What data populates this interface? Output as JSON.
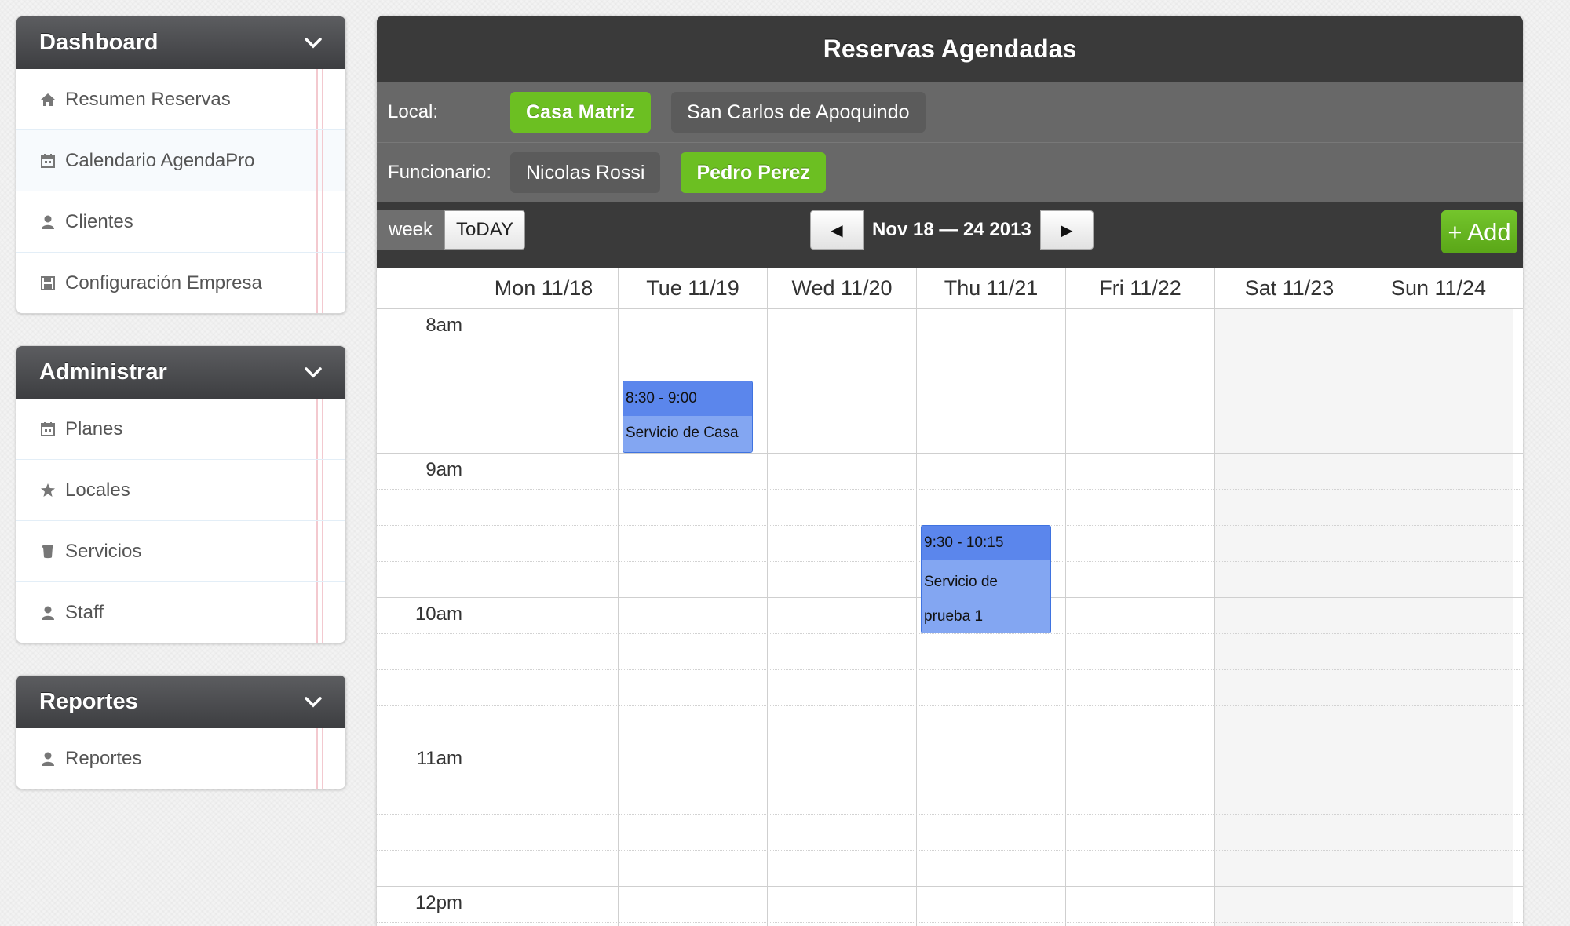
{
  "sidebar": {
    "dashboard": {
      "title": "Dashboard",
      "items": [
        {
          "label": "Resumen Reservas",
          "icon": "home-icon"
        },
        {
          "label": "Calendario AgendaPro",
          "icon": "calendar-icon"
        },
        {
          "label": "Clientes",
          "icon": "user-icon"
        },
        {
          "label": "Configuración Empresa",
          "icon": "save-icon"
        }
      ]
    },
    "administrar": {
      "title": "Administrar",
      "items": [
        {
          "label": "Planes",
          "icon": "calendar-icon"
        },
        {
          "label": "Locales",
          "icon": "star-icon"
        },
        {
          "label": "Servicios",
          "icon": "cup-icon"
        },
        {
          "label": "Staff",
          "icon": "user-icon"
        }
      ]
    },
    "reportes": {
      "title": "Reportes",
      "items": [
        {
          "label": "Reportes",
          "icon": "user-icon"
        }
      ]
    }
  },
  "calendar": {
    "title": "Reservas Agendadas",
    "local": {
      "label": "Local:",
      "options": [
        {
          "label": "Casa Matriz",
          "selected": true
        },
        {
          "label": "San Carlos de Apoquindo",
          "selected": false
        }
      ]
    },
    "funcionario": {
      "label": "Funcionario:",
      "options": [
        {
          "label": "Nicolas Rossi",
          "selected": false
        },
        {
          "label": "Pedro Perez",
          "selected": true
        }
      ]
    },
    "toolbar": {
      "week_label": "week",
      "today_label": "ToDAY",
      "prev_label": "◀",
      "next_label": "▶",
      "range_label": "Nov 18 — 24 2013",
      "add_label": "+ Add"
    },
    "days": [
      "Mon 11/18",
      "Tue 11/19",
      "Wed 11/20",
      "Thu 11/21",
      "Fri 11/22",
      "Sat 11/23",
      "Sun 11/24"
    ],
    "hours": [
      "8am",
      "9am",
      "10am",
      "11am",
      "12pm"
    ],
    "events": [
      {
        "time": "8:30 - 9:00",
        "title": "Servicio de Casa",
        "day": 1,
        "start_hour": 8.5,
        "end_hour": 9.0
      },
      {
        "time": "9:30 - 10:15",
        "title": "Servicio de prueba 1",
        "day": 3,
        "start_hour": 9.5,
        "end_hour": 10.25
      }
    ],
    "colors": {
      "accent_green": "#6cbf22",
      "event_fill": "#83a6f2",
      "event_header": "#5b86ec"
    }
  }
}
